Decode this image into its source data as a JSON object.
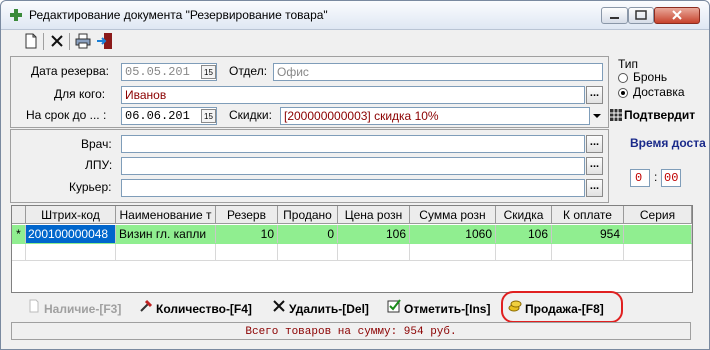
{
  "window": {
    "title": "Редактирование документа  \"Резервирование товара\""
  },
  "toolbar": {
    "new_icon": "document-icon",
    "delete_icon": "x-icon",
    "print_icon": "printer-icon",
    "exit_icon": "exit-door-icon"
  },
  "form": {
    "reserve_date_label": "Дата резерва:",
    "reserve_date_value": "05.05.201",
    "department_label": "Отдел:",
    "department_value": "Офис",
    "for_whom_label": "Для кого:",
    "for_whom_value": "Иванов",
    "term_label": "На срок до ... :",
    "term_value": "06.06.201",
    "discount_label": "Скидки:",
    "discount_value": "[200000000003] скидка 10%",
    "confirm_label": "Подтвердит",
    "type_label": "Тип",
    "type_options": [
      "Бронь",
      "Доставка"
    ],
    "type_selected": "Доставка",
    "doctor_label": "Врач:",
    "lpu_label": "ЛПУ:",
    "courier_label": "Курьер:",
    "delivery_time_label": "Время доста",
    "time_hours": "0",
    "time_minutes": "00",
    "ellipsis": "..."
  },
  "table": {
    "columns": [
      "Штрих-код",
      "Наименование т",
      "Резерв",
      "Продано",
      "Цена розн",
      "Сумма розн",
      "Скидка",
      "К оплате",
      "Серия"
    ],
    "rows": [
      {
        "marker": "*",
        "barcode": "200100000048",
        "name": "Визин гл. капли",
        "reserve": "10",
        "sold": "0",
        "price": "106",
        "sum": "1060",
        "discount": "106",
        "to_pay": "954",
        "series": ""
      }
    ]
  },
  "buttons": {
    "availability": "Наличие-[F3]",
    "quantity": "Количество-[F4]",
    "delete": "Удалить-[Del]",
    "mark": "Отметить-[Ins]",
    "sale": "Продажа-[F8]"
  },
  "status": {
    "total_text": "Всего товаров на сумму: 954 руб."
  },
  "colors": {
    "selected_row": "#90ee90",
    "selected_cell": "#0066cc",
    "status_text": "#8b0000",
    "highlight_ring": "#e02020",
    "discount_text": "#8b0000"
  }
}
